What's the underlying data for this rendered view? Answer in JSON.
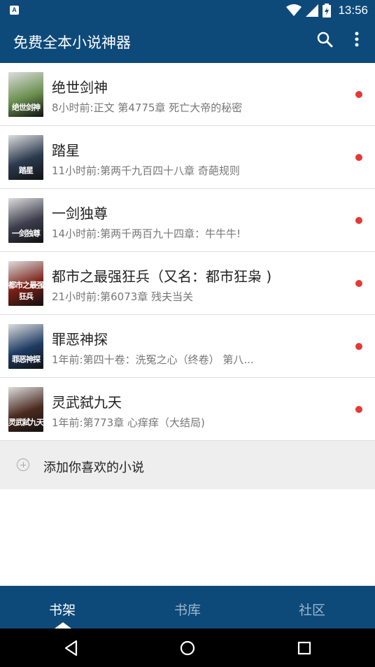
{
  "status_bar": {
    "time": "13:56",
    "icons": [
      "app-notification-icon",
      "wifi-icon",
      "cell-signal-icon",
      "battery-icon"
    ]
  },
  "app_bar": {
    "title": "免费全本小说神器",
    "actions": [
      "search-icon",
      "more-vert-icon"
    ]
  },
  "books": [
    {
      "title": "绝世剑神",
      "subtitle": "8小时前:正文 第4775章 死亡大帝的秘密",
      "cover_text": "绝世剑神",
      "cover_color": "#6a8f4e",
      "unread": true
    },
    {
      "title": "踏星",
      "subtitle": "11小时前:第两千九百四十八章   奇葩规则",
      "cover_text": "踏星",
      "cover_color": "#2b3a4e",
      "unread": true
    },
    {
      "title": "一剑独尊",
      "subtitle": "14小时前:第两千两百九十四章：牛牛牛!",
      "cover_text": "一剑独尊",
      "cover_color": "#3d3d4d",
      "unread": true
    },
    {
      "title": "都市之最强狂兵（又名：都市狂枭 )",
      "subtitle": "21小时前:第6073章 残夫当关",
      "cover_text": "都市之最强狂兵",
      "cover_color": "#7a1f16",
      "unread": true
    },
    {
      "title": "罪恶神探",
      "subtitle": "1年前:第四十卷：洗冤之心（终卷） 第八...",
      "cover_text": "罪恶神探",
      "cover_color": "#1d3b63",
      "unread": true
    },
    {
      "title": "灵武弑九天",
      "subtitle": "1年前:第773章 心痒痒（大结局)",
      "cover_text": "灵武弑九天",
      "cover_color": "#4a2a20",
      "unread": true
    }
  ],
  "add_novel": {
    "label": "添加你喜欢的小说",
    "icon": "add-circle-icon"
  },
  "tabs": [
    {
      "label": "书架",
      "active": true
    },
    {
      "label": "书库",
      "active": false
    },
    {
      "label": "社区",
      "active": false
    }
  ],
  "nav_bar": {
    "icons": [
      "back-icon",
      "home-icon",
      "recents-icon"
    ]
  },
  "colors": {
    "primary": "#0d4a7a",
    "unread_dot": "#e53935",
    "tab_inactive": "#9fb6c8"
  }
}
